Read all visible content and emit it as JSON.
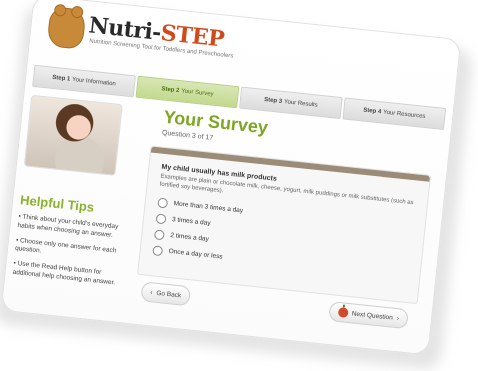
{
  "brand": {
    "name_left": "Nutri-",
    "name_right": "STEP",
    "tagline": "Nutrition Screening Tool for Toddlers and Preschoolers"
  },
  "steps": [
    {
      "step": "Step 1",
      "label": "Your Information",
      "active": false
    },
    {
      "step": "Step 2",
      "label": "Your Survey",
      "active": true
    },
    {
      "step": "Step 3",
      "label": "Your Results",
      "active": false
    },
    {
      "step": "Step 4",
      "label": "Your Resources",
      "active": false
    }
  ],
  "left": {
    "tips_title": "Helpful Tips",
    "tips": [
      "• Think about your child’s everyday habits when choosing an answer.",
      "• Choose only one answer for each question.",
      "• Use the Read Help button for additional help choosing an answer."
    ]
  },
  "survey": {
    "title": "Your Survey",
    "question_count": "Question 3 of 17",
    "question": "My child usually has milk products",
    "help_text": "Examples are plain or chocolate milk, cheese, yogurt, milk puddings or milk substitutes (such as fortified soy beverages).",
    "options": [
      "More than 3 times a day",
      "3 times a day",
      "2 times a day",
      "Once a day or less"
    ]
  },
  "nav": {
    "back_label": "Go Back",
    "next_label": "Next Question"
  },
  "colors": {
    "accent_green": "#7fa623",
    "brand_red": "#d04a1c",
    "question_bar": "#9b8c77"
  },
  "icons": {
    "mascot": "beaver-logo",
    "next": "apple-icon"
  }
}
